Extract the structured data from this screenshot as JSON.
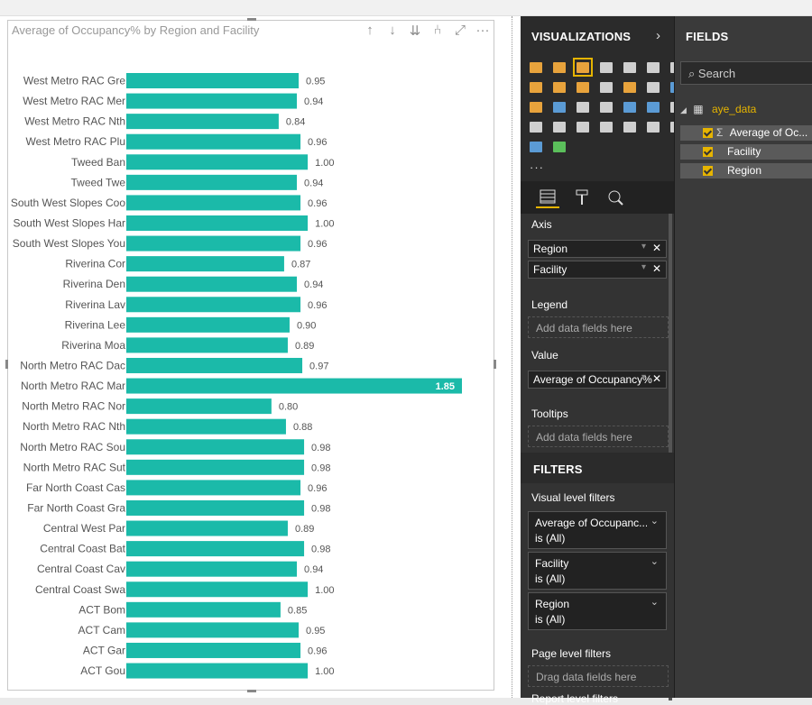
{
  "chart_data": {
    "type": "bar",
    "orientation": "horizontal",
    "title": "Average of Occupancy% by Region and Facility",
    "bar_color": "#1bbaa9",
    "categories": [
      "West Metro RAC Gre",
      "West Metro RAC Mer",
      "West Metro RAC Nth",
      "West Metro RAC Plu",
      "Tweed Ban",
      "Tweed Twe",
      "South West Slopes Coo",
      "South West Slopes Har",
      "South West Slopes You",
      "Riverina Cor",
      "Riverina Den",
      "Riverina Lav",
      "Riverina Lee",
      "Riverina Moa",
      "North Metro RAC Dac",
      "North Metro RAC Mar",
      "North Metro RAC Nor",
      "North Metro RAC Nth",
      "North Metro RAC Sou",
      "North Metro RAC Sut",
      "Far North Coast Cas",
      "Far North Coast Gra",
      "Central West Par",
      "Central Coast Bat",
      "Central Coast Cav",
      "Central Coast Swa",
      "ACT Bom",
      "ACT Cam",
      "ACT Gar",
      "ACT Gou"
    ],
    "values": [
      0.95,
      0.94,
      0.84,
      0.96,
      1.0,
      0.94,
      0.96,
      1.0,
      0.96,
      0.87,
      0.94,
      0.96,
      0.9,
      0.89,
      0.97,
      1.85,
      0.8,
      0.88,
      0.98,
      0.98,
      0.96,
      0.98,
      0.89,
      0.98,
      0.94,
      1.0,
      0.85,
      0.95,
      0.96,
      1.0
    ],
    "labels": [
      "0.95",
      "0.94",
      "0.84",
      "0.96",
      "1.00",
      "0.94",
      "0.96",
      "1.00",
      "0.96",
      "0.87",
      "0.94",
      "0.96",
      "0.90",
      "0.89",
      "0.97",
      "1.85",
      "0.80",
      "0.88",
      "0.98",
      "0.98",
      "0.96",
      "0.98",
      "0.89",
      "0.98",
      "0.94",
      "1.00",
      "0.85",
      "0.95",
      "0.96",
      "1.00"
    ],
    "xlim": [
      0,
      1.85
    ]
  },
  "visual_tools": {
    "drill_up": "↑",
    "drill_down": "↓",
    "next_level": "⇊",
    "expand": "⑃",
    "focus": "⤢",
    "more": "···"
  },
  "visualizations": {
    "title": "VISUALIZATIONS",
    "chevron": "›",
    "more": "···",
    "icons": [
      {
        "name": "stacked-bar-chart-icon",
        "color": "#e8a33c"
      },
      {
        "name": "stacked-column-chart-icon",
        "color": "#e8a33c"
      },
      {
        "name": "clustered-bar-chart-icon",
        "color": "#e8a33c",
        "selected": true
      },
      {
        "name": "clustered-column-chart-icon",
        "color": "#cfcfcf"
      },
      {
        "name": "100-stacked-bar-chart-icon",
        "color": "#cfcfcf"
      },
      {
        "name": "100-stacked-column-chart-icon",
        "color": "#cfcfcf"
      },
      {
        "name": "line-chart-icon",
        "color": "#cfcfcf"
      },
      {
        "name": "area-chart-icon",
        "color": "#e8a33c"
      },
      {
        "name": "stacked-area-chart-icon",
        "color": "#e8a33c"
      },
      {
        "name": "line-clustered-column-icon",
        "color": "#e8a33c"
      },
      {
        "name": "line-stacked-column-icon",
        "color": "#cfcfcf"
      },
      {
        "name": "ribbon-chart-icon",
        "color": "#e8a33c"
      },
      {
        "name": "waterfall-chart-icon",
        "color": "#cfcfcf"
      },
      {
        "name": "scatter-chart-icon",
        "color": "#5b9bd5"
      },
      {
        "name": "pie-chart-icon",
        "color": "#e8a33c"
      },
      {
        "name": "donut-chart-icon",
        "color": "#5b9bd5"
      },
      {
        "name": "treemap-icon",
        "color": "#cfcfcf"
      },
      {
        "name": "map-icon",
        "color": "#cfcfcf"
      },
      {
        "name": "filled-map-icon",
        "color": "#5b9bd5"
      },
      {
        "name": "shape-map-icon",
        "color": "#5b9bd5"
      },
      {
        "name": "funnel-icon",
        "color": "#cfcfcf"
      },
      {
        "name": "gauge-icon",
        "color": "#cfcfcf"
      },
      {
        "name": "card-icon",
        "color": "#cfcfcf"
      },
      {
        "name": "multi-row-card-icon",
        "color": "#cfcfcf"
      },
      {
        "name": "kpi-icon",
        "color": "#cfcfcf"
      },
      {
        "name": "slicer-icon",
        "color": "#cfcfcf"
      },
      {
        "name": "table-icon",
        "color": "#cfcfcf"
      },
      {
        "name": "matrix-icon",
        "color": "#cfcfcf"
      },
      {
        "name": "r-visual-icon",
        "color": "#5b9bd5"
      },
      {
        "name": "globe-icon",
        "color": "#5bbf5b"
      }
    ],
    "tabs": {
      "fields": "fields",
      "format": "format",
      "analytics": "analytics"
    }
  },
  "wells": {
    "axis_label": "Axis",
    "axis_fields": [
      "Region",
      "Facility"
    ],
    "legend_label": "Legend",
    "legend_placeholder": "Add data fields here",
    "value_label": "Value",
    "value_field": "Average of Occupancy%",
    "tooltips_label": "Tooltips",
    "tooltips_placeholder": "Add data fields here",
    "remove_glyph": "✕",
    "dropdown_glyph": "▾"
  },
  "filters": {
    "title": "FILTERS",
    "visual_level_label": "Visual level filters",
    "cards": [
      {
        "name": "Average of Occupanc...",
        "state": "is (All)"
      },
      {
        "name": "Facility",
        "state": "is (All)"
      },
      {
        "name": "Region",
        "state": "is (All)"
      }
    ],
    "chevron": "⌄",
    "page_level_label": "Page level filters",
    "page_placeholder": "Drag data fields here",
    "report_level_label": "Report level filters"
  },
  "fields": {
    "title": "FIELDS",
    "search_placeholder": "Search",
    "table_name": "aye_data",
    "items": [
      {
        "label": "Average of Oc...",
        "sigma": "Σ"
      },
      {
        "label": "Facility",
        "sigma": ""
      },
      {
        "label": "Region",
        "sigma": ""
      }
    ]
  }
}
